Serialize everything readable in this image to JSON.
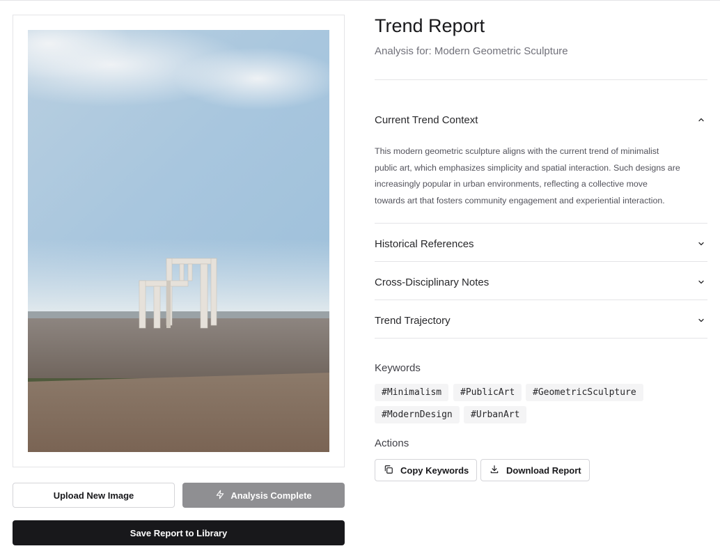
{
  "left": {
    "image_alt": "Modern geometric sculpture on a beach",
    "buttons": {
      "upload": "Upload New Image",
      "analysis": "Analysis Complete",
      "save": "Save Report to Library"
    }
  },
  "report": {
    "title": "Trend Report",
    "subtitle_prefix": "Analysis for:",
    "subtitle_value": "Modern Geometric Sculpture",
    "sections": [
      {
        "title": "Current Trend Context",
        "expanded": true,
        "lines": [
          "This modern geometric sculpture aligns with the current trend of minimalist",
          "public art, which emphasizes simplicity and spatial interaction. Such designs are",
          "increasingly popular in urban environments, reflecting a collective move",
          "towards art that fosters community engagement and experiential interaction."
        ]
      },
      {
        "title": "Historical References",
        "expanded": false
      },
      {
        "title": "Cross-Disciplinary Notes",
        "expanded": false
      },
      {
        "title": "Trend Trajectory",
        "expanded": false
      }
    ],
    "keywords_label": "Keywords",
    "keywords": [
      "#Minimalism",
      "#PublicArt",
      "#GeometricSculpture",
      "#ModernDesign",
      "#UrbanArt"
    ],
    "actions_label": "Actions",
    "actions": {
      "copy": "Copy Keywords",
      "download": "Download Report"
    }
  },
  "icons": {
    "analysis": "zap-icon",
    "copy": "copy-icon",
    "download": "download-icon",
    "expanded": "chevron-up-icon",
    "collapsed": "chevron-down-icon"
  },
  "colors": {
    "primary": "#18181b",
    "disabled_button": "#8f8f92",
    "tag_background": "#f4f4f5",
    "border": "#e4e4e7"
  }
}
